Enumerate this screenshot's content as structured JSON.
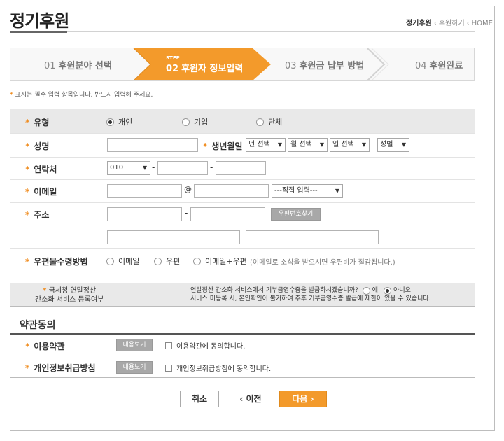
{
  "header": {
    "title": "정기후원",
    "breadcrumb": {
      "current": "정기후원",
      "sep": "‹",
      "mid": "후원하기",
      "home": "HOME"
    }
  },
  "steps": [
    {
      "num": "01",
      "label": "후원분야 선택"
    },
    {
      "tag": "STEP",
      "num": "02",
      "label": "후원자 정보입력",
      "active": true
    },
    {
      "num": "03",
      "label": "후원금 납부 방법"
    },
    {
      "num": "04",
      "label": "후원완료"
    }
  ],
  "notice": {
    "star": "*",
    "text": "표시는 필수 입력 항목입니다. 반드시 입력해 주세요."
  },
  "form": {
    "type": {
      "label": "유형",
      "options": [
        "개인",
        "기업",
        "단체"
      ],
      "selected": "개인"
    },
    "name": {
      "label": "성명",
      "value": ""
    },
    "birth": {
      "label": "생년월일",
      "year": "년 선택",
      "month": "월 선택",
      "day": "일 선택",
      "gender": "성별"
    },
    "phone": {
      "label": "연락처",
      "prefix": "010",
      "dash": "-"
    },
    "email": {
      "label": "이메일",
      "at": "@",
      "domain": "---직접 입력---"
    },
    "address": {
      "label": "주소",
      "dash": "-",
      "zip_button": "우편번호찾기"
    },
    "mail": {
      "label": "우편물수령방법",
      "options": [
        "이메일",
        "우편",
        "이메일+우편"
      ],
      "hint": "(이메일로 소식을 받으시면 우편비가 절감됩니다.)"
    },
    "tax": {
      "label1": "국세청 연말정산",
      "label2": "간소화 서비스 등록여부",
      "question": "연말정산 간소화 서비스에서 기부금영수증을 발급하시겠습니까?",
      "yes": "예",
      "no": "아니오",
      "selected": "아니오",
      "note": "서비스 미등록 시, 본인확인이 불가하여 추후 기부금영수증 발급에 제한이 있을 수 있습니다."
    }
  },
  "terms": {
    "title": "약관동의",
    "items": [
      {
        "label": "이용약관",
        "view": "내용보기",
        "agree": "이용약관에 동의합니다."
      },
      {
        "label": "개인정보취급방침",
        "view": "내용보기",
        "agree": "개인정보취급방침에 동의합니다."
      }
    ]
  },
  "buttons": {
    "cancel": "취소",
    "prev": "‹ 이전",
    "next": "다음 ›"
  },
  "colors": {
    "accent": "#f39a2b",
    "row_gray": "#e9e9e9"
  }
}
